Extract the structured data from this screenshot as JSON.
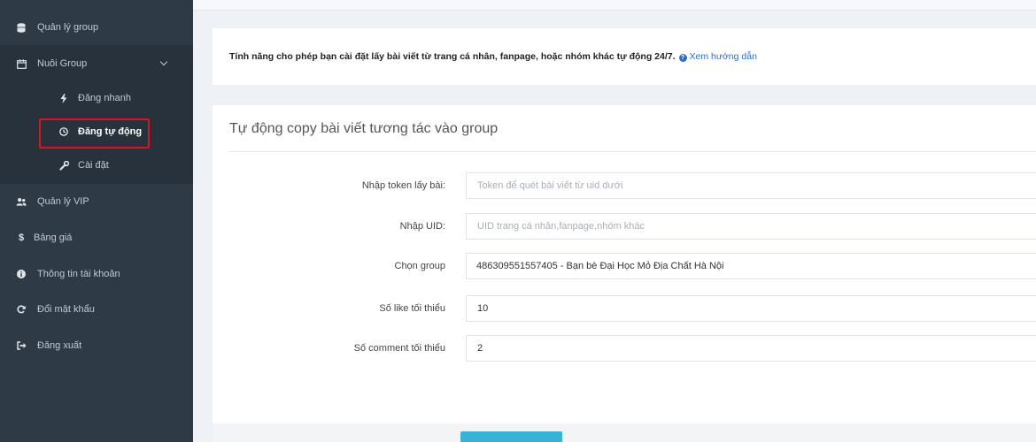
{
  "sidebar": {
    "items": [
      {
        "label": "Quản lý group",
        "icon": "database-icon"
      },
      {
        "label": "Nuôi Group",
        "icon": "calendar-icon"
      },
      {
        "label": "Quản lý VIP",
        "icon": "users-icon"
      },
      {
        "label": "Bảng giá",
        "icon": "dollar-icon"
      },
      {
        "label": "Thông tin tài khoản",
        "icon": "info-icon"
      },
      {
        "label": "Đổi mật khẩu",
        "icon": "refresh-icon"
      },
      {
        "label": "Đăng xuất",
        "icon": "sign-out-icon"
      }
    ],
    "sub_items": [
      {
        "label": "Đăng nhanh",
        "icon": "bolt-icon"
      },
      {
        "label": "Đăng tự động",
        "icon": "clock-icon",
        "active": true
      },
      {
        "label": "Cài đặt",
        "icon": "wrench-icon"
      }
    ]
  },
  "notice": {
    "text": "Tính năng cho phép bạn cài đặt lấy bài viết từ trang cá nhân, fanpage, hoặc nhóm khác tự động 24/7.",
    "link_icon": "?",
    "link_label": "Xem hướng dẫn"
  },
  "panel": {
    "title": "Tự động copy bài viết tương tác vào group",
    "fields": {
      "token": {
        "label": "Nhập token lấy bài:",
        "placeholder": "Token để quét bài viết từ uid dưới",
        "value": ""
      },
      "uid": {
        "label": "Nhập UID:",
        "placeholder": "UID trang cá nhân,fanpage,nhóm khác",
        "value": ""
      },
      "group": {
        "label": "Chọn group",
        "value": "486309551557405 - Bạn bè Đại Học Mỏ Địa Chất Hà Nội"
      },
      "min_like": {
        "label": "Số like tối thiểu",
        "value": "10"
      },
      "min_comment": {
        "label": "Số comment tối thiểu",
        "value": "2"
      }
    }
  },
  "colors": {
    "sidebar_bg": "#2e3a46",
    "highlight_border": "#e0121d",
    "link": "#2a6fc7",
    "button": "#36b3d6"
  }
}
